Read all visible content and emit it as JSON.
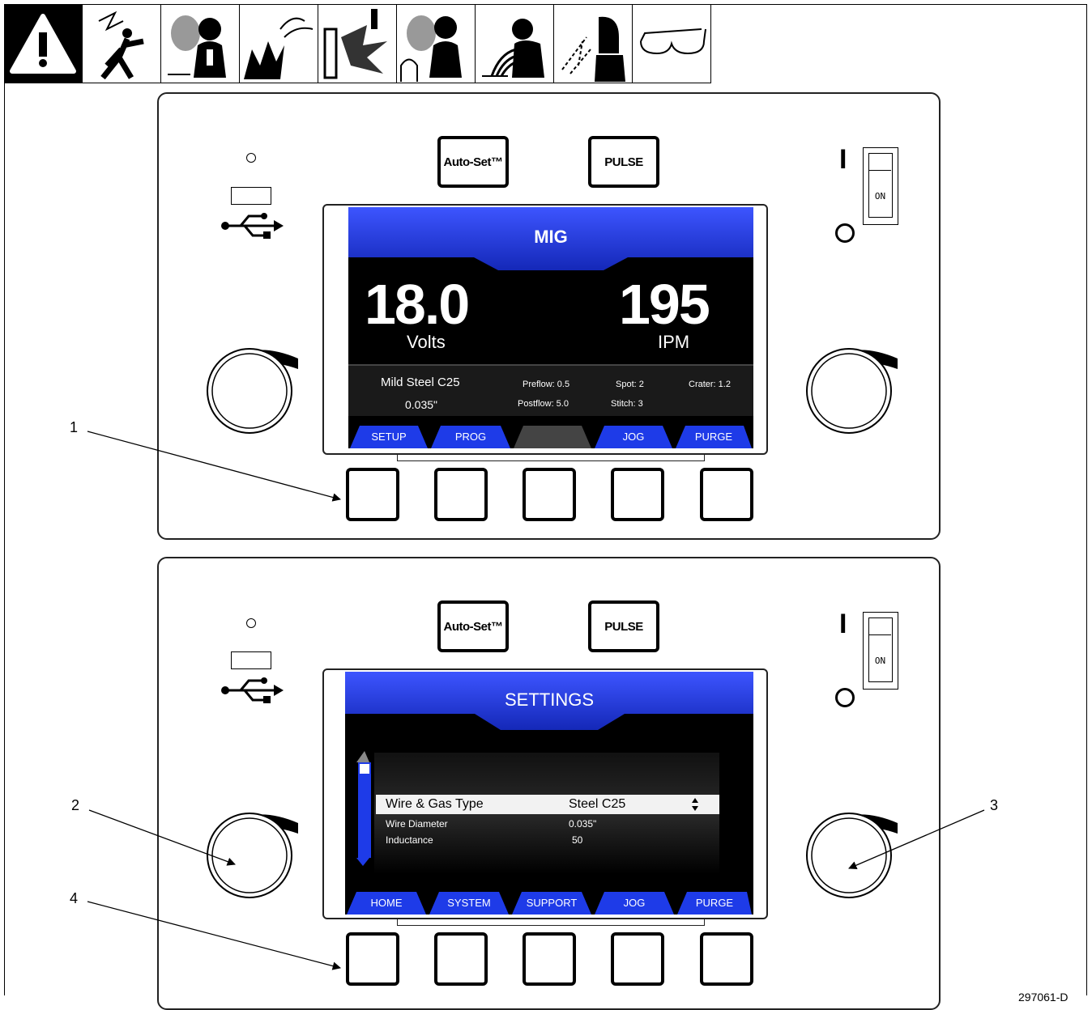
{
  "top_panel": {
    "autoset_label": "Auto-Set™",
    "pulse_label": "PULSE",
    "switch_on_label": "ON",
    "switch_i_label": "I",
    "screen": {
      "title": "MIG",
      "volts_value": "18.0",
      "volts_unit": "Volts",
      "ipm_value": "195",
      "ipm_unit": "IPM",
      "material": "Mild Steel C25",
      "wire_size": "0.035\"",
      "preflow": "Preflow: 0.5",
      "postflow": "Postflow: 5.0",
      "spot": "Spot:  2",
      "stitch": "Stitch:  3",
      "crater": "Crater: 1.2",
      "tabs": [
        "SETUP",
        "PROG",
        "",
        "JOG",
        "PURGE"
      ]
    }
  },
  "bottom_panel": {
    "autoset_label": "Auto-Set™",
    "pulse_label": "PULSE",
    "switch_on_label": "ON",
    "switch_i_label": "I",
    "screen": {
      "title": "SETTINGS",
      "rows": [
        {
          "name": "Wire & Gas Type",
          "value": "Steel C25"
        },
        {
          "name": "Wire Diameter",
          "value": "0.035\""
        },
        {
          "name": "Inductance",
          "value": "50"
        }
      ],
      "tabs": [
        "HOME",
        "SYSTEM",
        "SUPPORT",
        "JOG",
        "PURGE"
      ]
    }
  },
  "callouts": [
    "1",
    "2",
    "3",
    "4"
  ],
  "figure_id": "297061-D",
  "colors": {
    "screen_blue": "#1a2fd6",
    "screen_bg": "#000000"
  }
}
